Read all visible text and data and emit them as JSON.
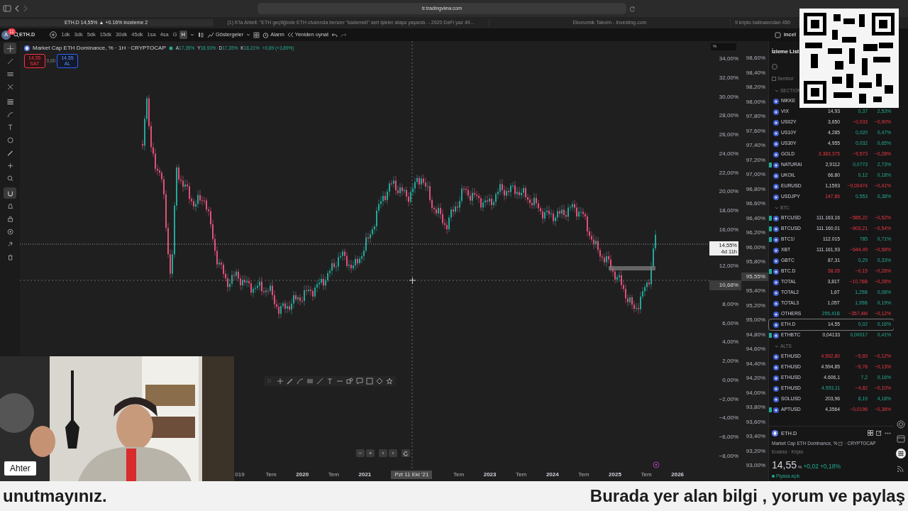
{
  "browser": {
    "url": "tr.tradingview.com",
    "tabs": [
      {
        "title": "ETH.D 14,55% ▲ +0.16% inceleme 2",
        "selected": true
      },
      {
        "title": "(1) K'la Ahtelt: \"ETH geçtiğinde ETH civarında benzer \"kademeli\" sert işleler alaşa yaşandı. - 2020 DeFi yaz 49...",
        "selected": false
      },
      {
        "title": "Ekonomik Takvim - Investing.com",
        "selected": false
      },
      {
        "title": "9 kripto balinasından 450",
        "selected": false
      }
    ]
  },
  "toolbar": {
    "avatar": "A",
    "notifications": "11",
    "symbol": "ETH.D",
    "intervals": [
      {
        "label": "1dk",
        "selected": false
      },
      {
        "label": "3dk",
        "selected": false
      },
      {
        "label": "5dk",
        "selected": false
      },
      {
        "label": "15dk",
        "selected": false
      },
      {
        "label": "30dk",
        "selected": false
      },
      {
        "label": "45dk",
        "selected": false
      },
      {
        "label": "1sa",
        "selected": false
      },
      {
        "label": "4sa",
        "selected": false
      },
      {
        "label": "G",
        "selected": false
      },
      {
        "label": "H",
        "selected": true
      }
    ],
    "indicators": "Göstergeler",
    "alert": "Alarm",
    "replay": "Yeniden oynat",
    "layout": "incel"
  },
  "left_toolbar": [
    {
      "selected": true
    },
    {
      "selected": false
    },
    {
      "selected": false
    },
    {
      "selected": false
    },
    {
      "selected": false
    },
    {
      "selected": false
    },
    {
      "selected": false
    },
    {
      "selected": false
    },
    {
      "selected": false
    },
    {
      "selected": false
    },
    {
      "selected": false
    },
    {
      "selected": true
    },
    {
      "selected": false
    },
    {
      "selected": false
    },
    {
      "selected": false
    },
    {
      "selected": false
    },
    {
      "selected": false
    }
  ],
  "legend": {
    "title": "Market Cap ETH Dominance, % · 1H · CRYPTOCAP",
    "ohlc": [
      {
        "key": "A",
        "value": "17,35%"
      },
      {
        "key": "Y",
        "value": "18,93%"
      },
      {
        "key": "D",
        "value": "17,35%"
      },
      {
        "key": "K",
        "value": "18,21%"
      }
    ],
    "change": "+0,89 (+3,89%)",
    "sell": {
      "price": "14,55",
      "label": "SAT"
    },
    "spread": "0,00",
    "buy": {
      "price": "14,55",
      "label": "AL"
    }
  },
  "left_axis": {
    "unit": "%",
    "ticks": [
      {
        "kind": "tick",
        "label": "34,00%"
      },
      {
        "kind": "tick",
        "label": "32,00%"
      },
      {
        "kind": "tick",
        "label": "30,00%"
      },
      {
        "kind": "tick",
        "label": "28,00%"
      },
      {
        "kind": "tick",
        "label": "26,00%"
      },
      {
        "kind": "tick",
        "label": "24,00%"
      },
      {
        "kind": "tick",
        "label": "22,00%"
      },
      {
        "kind": "tick",
        "label": "20,00%"
      },
      {
        "kind": "tick",
        "label": "18,00%"
      },
      {
        "kind": "tick",
        "label": "16,00%"
      },
      {
        "kind": "price",
        "label": "14,55%",
        "sub": "4d 11h"
      },
      {
        "kind": "tick",
        "label": "12,00%"
      },
      {
        "kind": "crosshair",
        "label": "10,68%"
      },
      {
        "kind": "tick",
        "label": "8,00%"
      },
      {
        "kind": "tick",
        "label": "6,00%"
      },
      {
        "kind": "tick",
        "label": "4,00%"
      },
      {
        "kind": "tick",
        "label": "2,00%"
      },
      {
        "kind": "tick",
        "label": "0,00%"
      },
      {
        "kind": "tick",
        "label": "−2,00%"
      },
      {
        "kind": "tick",
        "label": "−4,00%"
      },
      {
        "kind": "tick",
        "label": "−6,00%"
      },
      {
        "kind": "tick",
        "label": "−8,00%"
      }
    ]
  },
  "right_axis": {
    "ticks": [
      {
        "kind": "tick",
        "label": "98,60%"
      },
      {
        "kind": "tick",
        "label": "98,40%"
      },
      {
        "kind": "tick",
        "label": "98,20%"
      },
      {
        "kind": "tick",
        "label": "98,00%"
      },
      {
        "kind": "tick",
        "label": "97,80%"
      },
      {
        "kind": "tick",
        "label": "97,60%"
      },
      {
        "kind": "tick",
        "label": "97,40%"
      },
      {
        "kind": "tick",
        "label": "97,20%"
      },
      {
        "kind": "tick",
        "label": "97,00%"
      },
      {
        "kind": "tick",
        "label": "96,80%"
      },
      {
        "kind": "tick",
        "label": "96,60%"
      },
      {
        "kind": "tick",
        "label": "96,40%"
      },
      {
        "kind": "tick",
        "label": "96,20%"
      },
      {
        "kind": "tick",
        "label": "96,00%"
      },
      {
        "kind": "tick",
        "label": "95,80%"
      },
      {
        "kind": "crosshair",
        "label": "95,55%"
      },
      {
        "kind": "tick",
        "label": "95,40%"
      },
      {
        "kind": "tick",
        "label": "95,20%"
      },
      {
        "kind": "tick",
        "label": "95,00%"
      },
      {
        "kind": "tick",
        "label": "94,80%"
      },
      {
        "kind": "tick",
        "label": "94,60%"
      },
      {
        "kind": "tick",
        "label": "94,40%"
      },
      {
        "kind": "tick",
        "label": "94,20%"
      },
      {
        "kind": "tick",
        "label": "94,00%"
      },
      {
        "kind": "tick",
        "label": "93,80%"
      },
      {
        "kind": "tick",
        "label": "93,60%"
      },
      {
        "kind": "tick",
        "label": "93,40%"
      },
      {
        "kind": "tick",
        "label": "93,20%"
      },
      {
        "kind": "tick",
        "label": "93,00%"
      }
    ]
  },
  "time_axis": [
    {
      "kind": "tick",
      "label": "019"
    },
    {
      "kind": "tick",
      "label": "Tem"
    },
    {
      "kind": "year",
      "label": "2020"
    },
    {
      "kind": "tick",
      "label": "Tem"
    },
    {
      "kind": "year",
      "label": "2021"
    },
    {
      "kind": "crosshair",
      "label": "Pzt 11 Eki '21"
    },
    {
      "kind": "tick",
      "label": "Tem"
    },
    {
      "kind": "year",
      "label": "2023"
    },
    {
      "kind": "tick",
      "label": "Tem"
    },
    {
      "kind": "year",
      "label": "2024"
    },
    {
      "kind": "tick",
      "label": "Tem"
    },
    {
      "kind": "year",
      "label": "2025"
    },
    {
      "kind": "tick",
      "label": "Tem"
    },
    {
      "kind": "year",
      "label": "2026"
    }
  ],
  "zoom_controls": [
    "−",
    "+",
    "‹",
    "›"
  ],
  "watchlist": {
    "title": "İzleme List",
    "column": "Sembol",
    "items": [
      {
        "kind": "section",
        "label": "SECTION"
      },
      {
        "kind": "row",
        "symbol": "NIKKE",
        "flagged": false,
        "selected": false
      },
      {
        "kind": "row",
        "symbol": "VIX",
        "last": "14,93",
        "change": "0,37",
        "change_pct": "2,53%",
        "last_up": false,
        "last_down": false,
        "falling": false,
        "flagged": false,
        "selected": false
      },
      {
        "kind": "row",
        "symbol": "US02Y",
        "last": "3,650",
        "change": "−0,033",
        "change_pct": "−0,90%",
        "last_up": false,
        "last_down": false,
        "falling": true,
        "flagged": false,
        "selected": false
      },
      {
        "kind": "row",
        "symbol": "US10Y",
        "last": "4,285",
        "change": "0,020",
        "change_pct": "0,47%",
        "last_up": false,
        "last_down": false,
        "falling": false,
        "flagged": false,
        "selected": false
      },
      {
        "kind": "row",
        "symbol": "US30Y",
        "last": "4,955",
        "change": "0,032",
        "change_pct": "0,65%",
        "last_up": false,
        "last_down": false,
        "falling": false,
        "flagged": false,
        "selected": false
      },
      {
        "kind": "row",
        "symbol": "GOLD",
        "last": "3.383,375",
        "change": "−9,573",
        "change_pct": "−0,28%",
        "last_up": false,
        "last_down": true,
        "falling": true,
        "flagged": false,
        "selected": false
      },
      {
        "kind": "row",
        "symbol": "NATURAI",
        "last": "2,9112",
        "change": "0,0773",
        "change_pct": "2,73%",
        "last_up": false,
        "last_down": false,
        "falling": false,
        "flagged": true,
        "selected": false
      },
      {
        "kind": "row",
        "symbol": "UKOIL",
        "last": "66,80",
        "change": "0,12",
        "change_pct": "0,18%",
        "last_up": false,
        "last_down": false,
        "falling": false,
        "flagged": false,
        "selected": false
      },
      {
        "kind": "row",
        "symbol": "EURUSD",
        "last": "1,1593",
        "change": "−0,00474",
        "change_pct": "−0,41%",
        "last_up": false,
        "last_down": false,
        "falling": true,
        "flagged": false,
        "selected": false
      },
      {
        "kind": "row",
        "symbol": "USDJPY",
        "last": "147,86",
        "change": "0,553",
        "change_pct": "0,38%",
        "last_up": false,
        "last_down": true,
        "falling": false,
        "flagged": false,
        "selected": false
      },
      {
        "kind": "section",
        "label": "BTC"
      },
      {
        "kind": "row",
        "symbol": "BTCUSD",
        "last": "111.163,16",
        "change": "−585,22",
        "change_pct": "−0,52%",
        "last_up": false,
        "last_down": false,
        "falling": true,
        "flagged": true,
        "selected": false
      },
      {
        "kind": "row",
        "symbol": "BTCUSD",
        "last": "111.160,01",
        "change": "−603,21",
        "change_pct": "−0,54%",
        "last_up": false,
        "last_down": false,
        "falling": true,
        "flagged": true,
        "selected": false
      },
      {
        "kind": "row",
        "symbol": "BTC1!",
        "last": "112.015",
        "change": "785",
        "change_pct": "0,71%",
        "last_up": false,
        "last_down": false,
        "falling": false,
        "flagged": true,
        "selected": false
      },
      {
        "kind": "row",
        "symbol": "XBT",
        "last": "111.161,93",
        "change": "−644,49",
        "change_pct": "−0,58%",
        "last_up": false,
        "last_down": false,
        "falling": true,
        "flagged": false,
        "selected": false
      },
      {
        "kind": "row",
        "symbol": "GBTC",
        "last": "87,31",
        "change": "0,29",
        "change_pct": "0,33%",
        "last_up": false,
        "last_down": false,
        "falling": false,
        "flagged": false,
        "selected": false
      },
      {
        "kind": "row",
        "symbol": "BTC.D",
        "last": "58,05",
        "change": "−0,15",
        "change_pct": "−0,26%",
        "last_up": false,
        "last_down": true,
        "falling": true,
        "flagged": true,
        "selected": false
      },
      {
        "kind": "row",
        "symbol": "TOTAL",
        "last": "3,81T",
        "change": "−10,76B",
        "change_pct": "−0,28%",
        "last_up": false,
        "last_down": false,
        "falling": true,
        "flagged": false,
        "selected": false
      },
      {
        "kind": "row",
        "symbol": "TOTAL2",
        "last": "1,6T",
        "change": "1,25B",
        "change_pct": "0,08%",
        "last_up": false,
        "last_down": false,
        "falling": false,
        "flagged": false,
        "selected": false
      },
      {
        "kind": "row",
        "symbol": "TOTAL3",
        "last": "1,05T",
        "change": "1,95B",
        "change_pct": "0,19%",
        "last_up": false,
        "last_down": false,
        "falling": false,
        "flagged": false,
        "selected": false
      },
      {
        "kind": "row",
        "symbol": "OTHERS",
        "last": "295,41B",
        "change": "−357,4M",
        "change_pct": "−0,12%",
        "last_up": true,
        "last_down": false,
        "falling": true,
        "flagged": false,
        "selected": false
      },
      {
        "kind": "row",
        "symbol": "ETH.D",
        "last": "14,55",
        "change": "0,02",
        "change_pct": "0,16%",
        "last_up": false,
        "last_down": false,
        "falling": false,
        "flagged": false,
        "selected": true
      },
      {
        "kind": "row",
        "symbol": "ETHBTC",
        "last": "0,04133",
        "change": "0,00017",
        "change_pct": "0,41%",
        "last_up": false,
        "last_down": false,
        "falling": false,
        "flagged": true,
        "selected": false
      },
      {
        "kind": "section",
        "label": "ALTS"
      },
      {
        "kind": "row",
        "symbol": "ETHUSD",
        "last": "4.592,80",
        "change": "−5,69",
        "change_pct": "−0,12%",
        "last_up": false,
        "last_down": true,
        "falling": true,
        "flagged": false,
        "selected": false
      },
      {
        "kind": "row",
        "symbol": "ETHUSD",
        "last": "4.594,85",
        "change": "−5,78",
        "change_pct": "−0,13%",
        "last_up": false,
        "last_down": false,
        "falling": true,
        "flagged": false,
        "selected": false
      },
      {
        "kind": "row",
        "symbol": "ETHUSD",
        "last": "4.606,1",
        "change": "7,2",
        "change_pct": "0,16%",
        "last_up": false,
        "last_down": false,
        "falling": false,
        "flagged": false,
        "selected": false
      },
      {
        "kind": "row",
        "symbol": "ETHUSD",
        "last": "4.593,11",
        "change": "−4,82",
        "change_pct": "−0,10%",
        "last_up": true,
        "last_down": false,
        "falling": true,
        "flagged": false,
        "selected": false
      },
      {
        "kind": "row",
        "symbol": "SOLUSD",
        "last": "203,96",
        "change": "8,19",
        "change_pct": "4,18%",
        "last_up": false,
        "last_down": false,
        "falling": false,
        "flagged": false,
        "selected": false
      },
      {
        "kind": "row",
        "symbol": "APTUSD",
        "last": "4,3564",
        "change": "−0,0196",
        "change_pct": "−0,36%",
        "last_up": false,
        "last_down": false,
        "falling": true,
        "flagged": true,
        "selected": false
      }
    ]
  },
  "details": {
    "symbol": "ETH.D",
    "description": "Market Cap ETH Dominance, %",
    "source": "· CRYPTOCAP",
    "category": "Endeks · Kripto",
    "price": "14,55",
    "unit": "%",
    "change": "+0,02",
    "change_pct": "+0,18%",
    "status": "Piyasa açık"
  },
  "webcam": {
    "name_tag": "Ahter"
  },
  "subtitles": [
    "unutmayınız.",
    "Burada yer alan bilgi , yorum ve paylaş"
  ]
}
